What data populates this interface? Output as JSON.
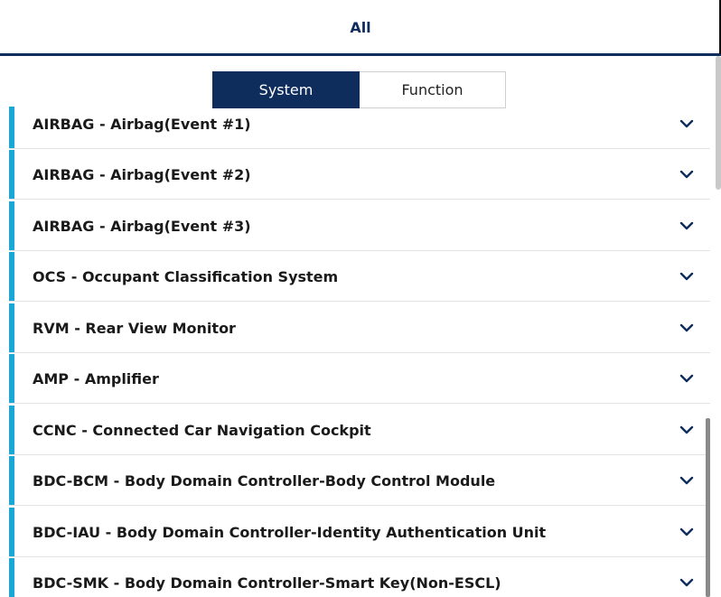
{
  "top_tabs": {
    "active_label": "All"
  },
  "segmented_control": {
    "options": [
      "System",
      "Function"
    ],
    "selected": "System"
  },
  "system_list": {
    "items": [
      "AIRBAG - Airbag(Event #1)",
      "AIRBAG - Airbag(Event #2)",
      "AIRBAG - Airbag(Event #3)",
      "OCS - Occupant Classification System",
      "RVM - Rear View Monitor",
      "AMP - Amplifier",
      "CCNC - Connected Car Navigation Cockpit",
      "BDC-BCM - Body Domain Controller-Body Control Module",
      "BDC-IAU - Body Domain Controller-Identity Authentication Unit",
      "BDC-SMK - Body Domain Controller-Smart Key(Non-ESCL)"
    ],
    "expand_icon": "chevron-down-icon"
  },
  "colors": {
    "primary": "#0f2d5c",
    "accent_bar": "#1aa7d8",
    "divider": "#e3e3e3"
  }
}
